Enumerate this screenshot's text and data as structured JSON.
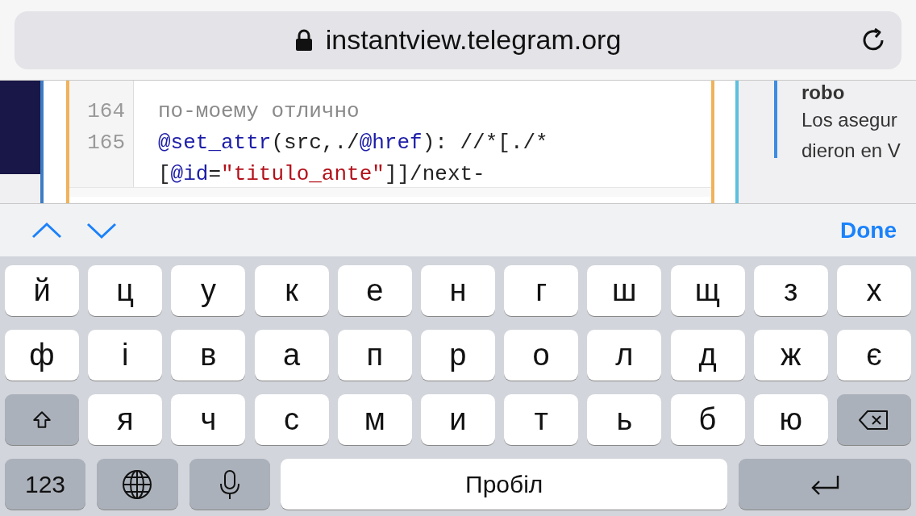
{
  "address_bar": {
    "url": "instantview.telegram.org"
  },
  "code": {
    "lines": [
      {
        "number": "164",
        "segments": [
          {
            "kind": "comment",
            "text": "по-моему отлично"
          }
        ]
      },
      {
        "number": "165",
        "segments": [
          {
            "kind": "function",
            "text": "@set_attr"
          },
          {
            "kind": "plain",
            "text": "(src,./"
          },
          {
            "kind": "function",
            "text": "@href"
          },
          {
            "kind": "plain",
            "text": "): //*[./*"
          }
        ]
      },
      {
        "segments": [
          {
            "kind": "plain",
            "text": "["
          },
          {
            "kind": "function",
            "text": "@id"
          },
          {
            "kind": "plain",
            "text": "="
          },
          {
            "kind": "string",
            "text": "\"titulo_ante\""
          },
          {
            "kind": "plain",
            "text": "]]/next-"
          }
        ]
      }
    ]
  },
  "comment": {
    "author": "robo",
    "lines": [
      "Los asegur",
      "dieron en V"
    ]
  },
  "accessory_bar": {
    "done": "Done"
  },
  "keyboard": {
    "rows": [
      [
        {
          "kind": "letter",
          "label": "й"
        },
        {
          "kind": "letter",
          "label": "ц"
        },
        {
          "kind": "letter",
          "label": "у"
        },
        {
          "kind": "letter",
          "label": "к"
        },
        {
          "kind": "letter",
          "label": "е"
        },
        {
          "kind": "letter",
          "label": "н"
        },
        {
          "kind": "letter",
          "label": "г"
        },
        {
          "kind": "letter",
          "label": "ш"
        },
        {
          "kind": "letter",
          "label": "щ"
        },
        {
          "kind": "letter",
          "label": "з"
        },
        {
          "kind": "letter",
          "label": "х"
        }
      ],
      [
        {
          "kind": "letter",
          "label": "ф"
        },
        {
          "kind": "letter",
          "label": "і"
        },
        {
          "kind": "letter",
          "label": "в"
        },
        {
          "kind": "letter",
          "label": "а"
        },
        {
          "kind": "letter",
          "label": "п"
        },
        {
          "kind": "letter",
          "label": "р"
        },
        {
          "kind": "letter",
          "label": "о"
        },
        {
          "kind": "letter",
          "label": "л"
        },
        {
          "kind": "letter",
          "label": "д"
        },
        {
          "kind": "letter",
          "label": "ж"
        },
        {
          "kind": "letter",
          "label": "є"
        }
      ],
      [
        {
          "kind": "shift"
        },
        {
          "kind": "letter",
          "label": "я"
        },
        {
          "kind": "letter",
          "label": "ч"
        },
        {
          "kind": "letter",
          "label": "с"
        },
        {
          "kind": "letter",
          "label": "м"
        },
        {
          "kind": "letter",
          "label": "и"
        },
        {
          "kind": "letter",
          "label": "т"
        },
        {
          "kind": "letter",
          "label": "ь"
        },
        {
          "kind": "letter",
          "label": "б"
        },
        {
          "kind": "letter",
          "label": "ю"
        },
        {
          "kind": "backspace"
        }
      ],
      [
        {
          "kind": "numbers",
          "label": "123"
        },
        {
          "kind": "globe"
        },
        {
          "kind": "mic"
        },
        {
          "kind": "space",
          "label": "Пробіл"
        },
        {
          "kind": "return"
        }
      ]
    ]
  }
}
